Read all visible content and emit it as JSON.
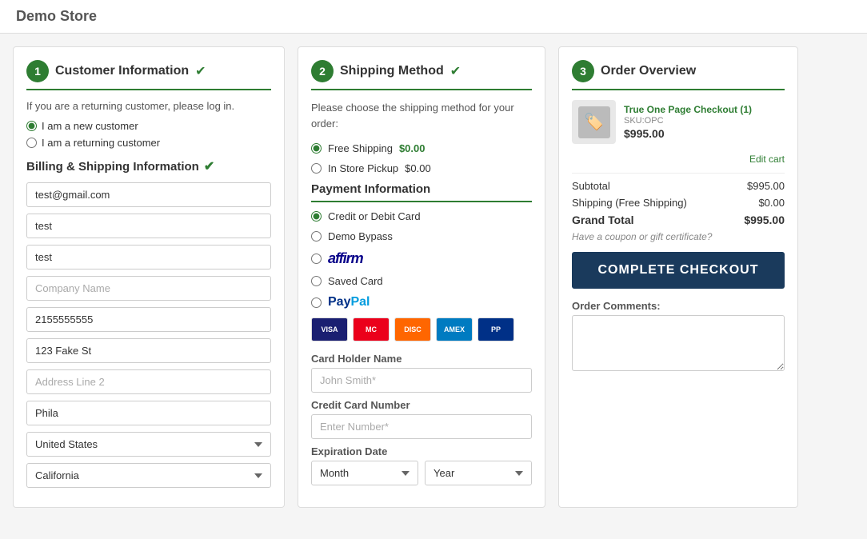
{
  "header": {
    "store_name": "Demo Store"
  },
  "customer_section": {
    "step": "1",
    "title": "Customer Information",
    "returning_text": "If you are a returning customer, please log in.",
    "new_customer_label": "I am a new customer",
    "returning_customer_label": "I am a returning customer",
    "billing_title": "Billing & Shipping Information",
    "fields": {
      "email": "test@gmail.com",
      "first_name": "test",
      "last_name": "test",
      "company_placeholder": "Company Name",
      "phone": "2155555555",
      "address1": "123 Fake St",
      "address2_placeholder": "Address Line 2",
      "city": "Phila",
      "country": "United States",
      "state": "California"
    }
  },
  "shipping_section": {
    "step": "2",
    "title": "Shipping Method",
    "description": "Please choose the shipping method for your order:",
    "options": [
      {
        "id": "free",
        "label": "Free Shipping",
        "price": "$0.00",
        "selected": true
      },
      {
        "id": "instore",
        "label": "In Store Pickup",
        "price": "$0.00",
        "selected": false
      }
    ],
    "payment_title": "Payment Information",
    "payment_options": [
      {
        "id": "credit",
        "label": "Credit or Debit Card",
        "selected": true
      },
      {
        "id": "demo",
        "label": "Demo Bypass",
        "selected": false
      },
      {
        "id": "affirm",
        "label": "Affirm",
        "type": "logo",
        "selected": false
      },
      {
        "id": "saved",
        "label": "Saved Card",
        "selected": false
      },
      {
        "id": "paypal",
        "label": "PayPal",
        "type": "logo",
        "selected": false
      }
    ],
    "card_logos": [
      "VISA",
      "MC",
      "DISC",
      "AMEX",
      "PP"
    ],
    "card_holder_label": "Card Holder Name",
    "card_holder_placeholder": "John Smith*",
    "card_number_label": "Credit Card Number",
    "card_number_placeholder": "Enter Number*",
    "expiry_label": "Expiration Date",
    "month_label": "Month",
    "year_label": "Year"
  },
  "order_section": {
    "step": "3",
    "title": "Order Overview",
    "product": {
      "name": "True One Page Checkout",
      "qty": "(1)",
      "sku": "SKU:OPC",
      "price": "$995.00"
    },
    "edit_cart_label": "Edit cart",
    "subtotal_label": "Subtotal",
    "subtotal_value": "$995.00",
    "shipping_label": "Shipping (Free Shipping)",
    "shipping_value": "$0.00",
    "grand_total_label": "Grand Total",
    "grand_total_value": "$995.00",
    "coupon_text": "Have a coupon or gift certificate?",
    "checkout_button": "COMPLETE CHECKOUT",
    "comments_label": "Order Comments:"
  }
}
